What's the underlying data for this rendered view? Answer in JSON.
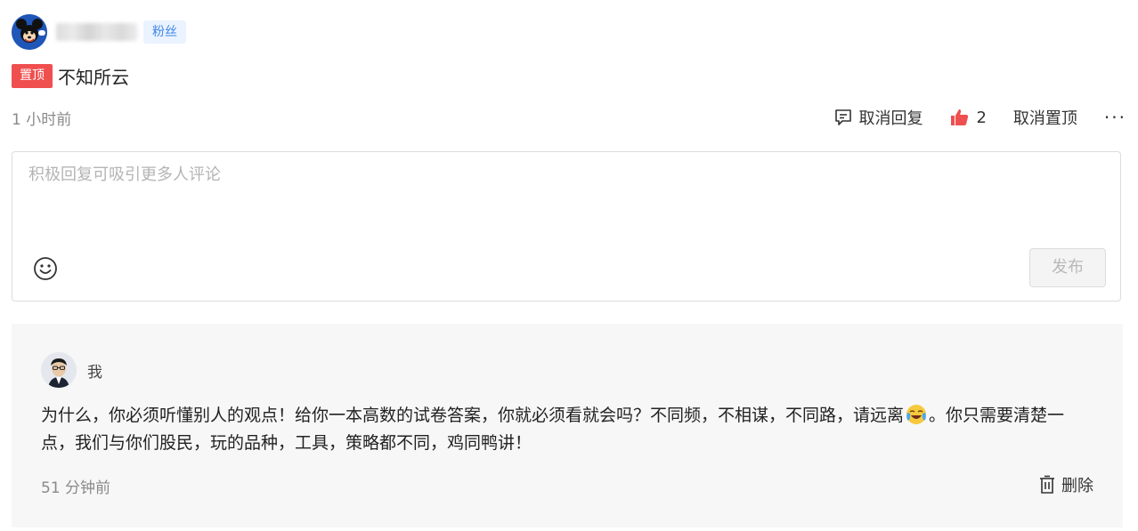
{
  "comment": {
    "badge": "粉丝",
    "pin_tag": "置顶",
    "text": "不知所云",
    "time": "1 小时前",
    "actions": {
      "cancel_reply": "取消回复",
      "like_count": "2",
      "cancel_pin": "取消置顶",
      "more": "···"
    }
  },
  "reply_box": {
    "placeholder": "积极回复可吸引更多人评论",
    "publish_label": "发布"
  },
  "my_reply": {
    "author": "我",
    "content_before_emoji": "为什么，你必须听懂别人的观点！给你一本高数的试卷答案，你就必须看就会吗？不同频，不相谋，不同路，请远离",
    "content_after_emoji": "。你只需要清楚一点，我们与你们股民，玩的品种，工具，策略都不同，鸡同鸭讲！",
    "time": "51 分钟前",
    "delete_label": "删除"
  },
  "colors": {
    "pin_red": "#f04f4f",
    "badge_blue": "#3f86e8",
    "like_red": "#f04f4f"
  }
}
